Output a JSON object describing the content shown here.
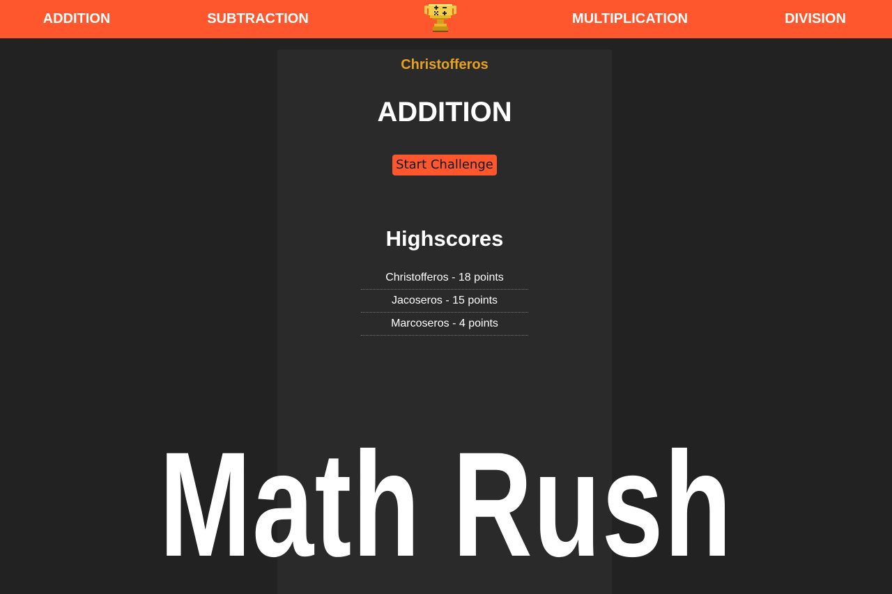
{
  "nav": {
    "addition": "ADDITION",
    "subtraction": "SUBTRACTION",
    "multiplication": "MULTIPLICATION",
    "division": "DIVISION",
    "logo_icon": "trophy-icon"
  },
  "panel": {
    "username": "Christofferos",
    "mode_title": "ADDITION",
    "start_button": "Start Challenge",
    "highscores_title": "Highscores",
    "highscores": [
      "Christofferos - 18 points",
      "Jacoseros - 15 points",
      "Marcoseros - 4 points"
    ]
  },
  "hero": {
    "title": "Math Rush"
  },
  "colors": {
    "accent": "#ff572d",
    "background": "#222222",
    "panel": "#2a2a2a",
    "username": "#e6a21f"
  }
}
